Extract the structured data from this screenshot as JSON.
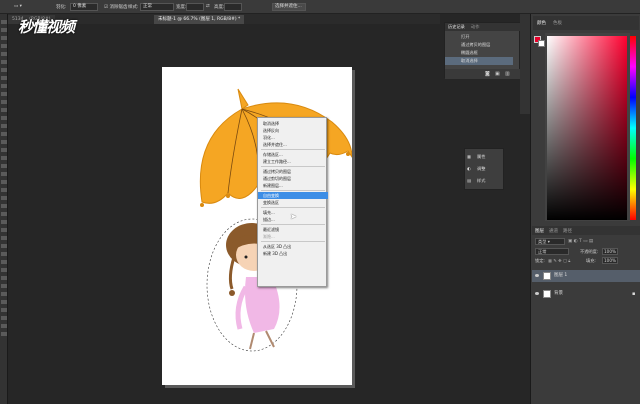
{
  "option_bar": {
    "feather_label": "羽化:",
    "feather_value": "0 像素",
    "antialias_label": "消除锯齿",
    "style_label": "样式:",
    "style_value": "正常",
    "width_label": "宽度:",
    "height_label": "高度:",
    "select_mask_button": "选择并遮住..."
  },
  "tabs": [
    {
      "label": "5134... (RGB/8#)",
      "active": false
    },
    {
      "label": "未标题-1 @ 66.7% (图层 1, RGB/8#) *",
      "active": true
    }
  ],
  "watermark": "秒懂视频",
  "context_menu": {
    "items": [
      {
        "label": "取消选择",
        "state": "normal"
      },
      {
        "label": "选择反向",
        "state": "normal"
      },
      {
        "label": "羽化...",
        "state": "normal"
      },
      {
        "label": "选择并遮住...",
        "state": "normal"
      },
      {
        "sep": true
      },
      {
        "label": "存储选区...",
        "state": "normal"
      },
      {
        "label": "建立工作路径...",
        "state": "normal"
      },
      {
        "sep": true
      },
      {
        "label": "通过拷贝的图层",
        "state": "normal"
      },
      {
        "label": "通过剪切的图层",
        "state": "normal"
      },
      {
        "label": "新建图层...",
        "state": "normal"
      },
      {
        "sep": true
      },
      {
        "label": "自由变换",
        "state": "highlight"
      },
      {
        "label": "变换选区",
        "state": "normal"
      },
      {
        "sep": true
      },
      {
        "label": "填充...",
        "state": "normal"
      },
      {
        "label": "描边...",
        "state": "normal"
      },
      {
        "sep": true
      },
      {
        "label": "最近滤镜",
        "state": "normal"
      },
      {
        "label": "渐隐...",
        "state": "disabled"
      },
      {
        "sep": true
      },
      {
        "label": "从选区 3D 凸出",
        "state": "normal"
      },
      {
        "label": "新建 3D 凸出",
        "state": "normal"
      }
    ]
  },
  "history_panel": {
    "tabs": [
      "历史记录",
      "动作"
    ],
    "items": [
      {
        "label": "打开",
        "selected": false
      },
      {
        "label": "通过拷贝的图层",
        "selected": false
      },
      {
        "label": "椭圆选框",
        "selected": false
      },
      {
        "label": "取消选择",
        "selected": true
      }
    ]
  },
  "mini_panel": {
    "items": [
      "属性",
      "调整",
      "样式"
    ]
  },
  "color_panel": {
    "tabs": [
      "颜色",
      "色板"
    ],
    "fg_color": "#e8002a",
    "bg_color": "#ffffff"
  },
  "layers_panel": {
    "tabs": [
      "图层",
      "通道",
      "路径"
    ],
    "kind_label": "类型",
    "blend_mode": "正常",
    "opacity_label": "不透明度:",
    "opacity_value": "100%",
    "lock_label": "锁定:",
    "fill_label": "填充:",
    "fill_value": "100%",
    "layers": [
      {
        "name": "图层 1",
        "selected": true
      },
      {
        "name": "背景",
        "selected": false
      }
    ]
  },
  "colors": {
    "umbrella": "#f5a623",
    "umbrella_dark": "#d98a0f",
    "dress": "#f1b8e6",
    "hair": "#8b5a2b",
    "skin": "#f6d3b5",
    "highlight": "#3d8ee6"
  }
}
